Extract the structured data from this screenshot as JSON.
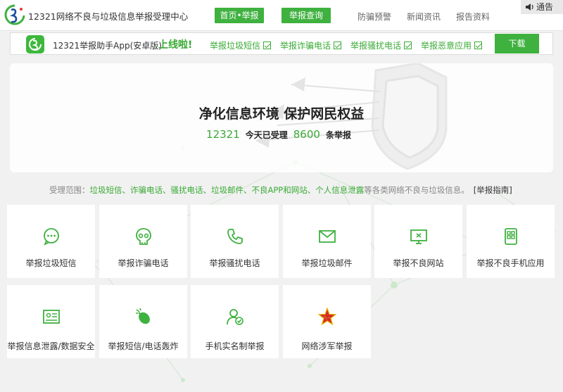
{
  "header": {
    "site_title": "12321网络不良与垃圾信息举报受理中心",
    "nav_home": "首页•举报",
    "nav_query": "举报查询",
    "nav_links": [
      "防骗预警",
      "新闻资讯",
      "报告资料"
    ],
    "notice": "通告"
  },
  "appbar": {
    "app_name": "12321举报助手App(安卓版)",
    "online": "上线啦!",
    "features": [
      "举报垃圾短信",
      "举报诈骗电话",
      "举报骚扰电话",
      "举报恶意应用"
    ],
    "download": "下载"
  },
  "hero": {
    "slogan": "净化信息环境 保护网民权益",
    "stat1_num": "12321",
    "stat1_label": "今天已受理",
    "stat2_num": "8600",
    "stat2_label": "条举报"
  },
  "scope": {
    "prefix": "受理范围：",
    "items": "垃圾短信、诈骗电话、骚扰电话、垃圾邮件、不良APP和网站、个人信息泄露",
    "suffix": "等各类网络不良与垃圾信息。",
    "guide": "[举报指南]"
  },
  "cards": [
    {
      "label": "举报垃圾短信",
      "icon": "chat-bubble-icon"
    },
    {
      "label": "举报诈骗电话",
      "icon": "skull-icon"
    },
    {
      "label": "举报骚扰电话",
      "icon": "phone-icon"
    },
    {
      "label": "举报垃圾邮件",
      "icon": "mail-icon"
    },
    {
      "label": "举报不良网站",
      "icon": "monitor-icon"
    },
    {
      "label": "举报不良手机应用",
      "icon": "mobile-app-icon"
    },
    {
      "label": "举报信息泄露/数据安全",
      "icon": "id-card-icon"
    },
    {
      "label": "举报短信/电话轰炸",
      "icon": "bomb-icon"
    },
    {
      "label": "手机实名制举报",
      "icon": "user-check-icon"
    },
    {
      "label": "网络涉军举报",
      "icon": "army-star-icon"
    }
  ],
  "colors": {
    "accent": "#3fb13f",
    "text_green": "#3aaa35"
  }
}
